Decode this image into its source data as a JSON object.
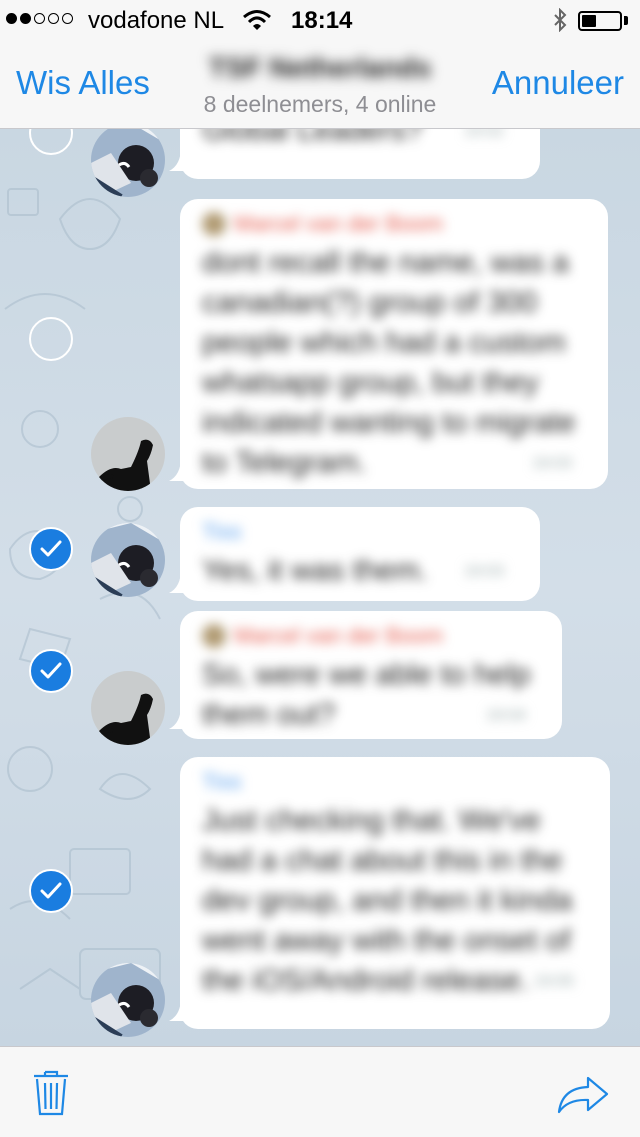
{
  "status_bar": {
    "signal_dots_filled": 2,
    "signal_dots_total": 5,
    "carrier": "vodafone NL",
    "time": "18:14",
    "wifi_icon": "wifi-icon",
    "bluetooth_icon": "bluetooth-icon",
    "battery_percent": 40
  },
  "nav": {
    "left_label": "Wis Alles",
    "title": "TSF Netherlands",
    "subtitle": "8 deelnemers, 4 online",
    "right_label": "Annuleer",
    "accent_color": "#1e88e5"
  },
  "messages": [
    {
      "selected": false,
      "avatar": "avatar-comic",
      "sender": "",
      "text": "Global Leaders?",
      "time": "19:02"
    },
    {
      "selected": false,
      "avatar": "avatar-silhouette",
      "sender": "Marcel van der Boom",
      "sender_color": "#e55b4d",
      "text": "dont recall the name, was a canadian(?) group of 300 people which had a custom whatsapp group, but they indicated wanting to migrate to Telegram.",
      "time": "19:03"
    },
    {
      "selected": true,
      "avatar": "avatar-comic",
      "sender": "Tiss",
      "sender_color": "#5aa0ee",
      "text": "Yes, it was them.",
      "time": "19:03"
    },
    {
      "selected": true,
      "avatar": "avatar-silhouette",
      "sender": "Marcel van der Boom",
      "sender_color": "#e55b4d",
      "text": "So, were we able to help them out?",
      "time": "19:04"
    },
    {
      "selected": true,
      "avatar": "avatar-comic",
      "sender": "Tiss",
      "sender_color": "#5aa0ee",
      "text": "Just checking that. We've had a chat about this in the dev group, and then it kinda went away with the onset of the iOS/Android release.",
      "time": "19:05"
    }
  ],
  "toolbar": {
    "delete_icon": "trash-icon",
    "forward_icon": "forward-arrow-icon"
  },
  "colors": {
    "check_blue": "#1a7de0",
    "chat_background": "#cfdbe5"
  }
}
